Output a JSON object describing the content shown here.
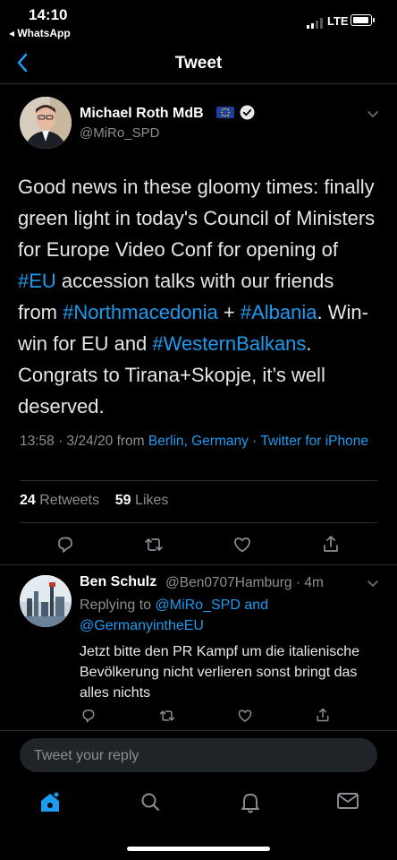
{
  "status_bar": {
    "time": "14:10",
    "back_app": "◂ WhatsApp",
    "network": "LTE"
  },
  "header": {
    "title": "Tweet"
  },
  "tweet": {
    "author_name": "Michael Roth MdB",
    "author_handle": "@MiRo_SPD",
    "text_segments": [
      {
        "t": "Good news in these gloomy times: finally green light in today's Council of Ministers for Europe Video Conf for opening of ",
        "link": false
      },
      {
        "t": "#EU",
        "link": true
      },
      {
        "t": " accession talks with our friends from ",
        "link": false
      },
      {
        "t": "#Northmacedonia",
        "link": true
      },
      {
        "t": " + ",
        "link": false
      },
      {
        "t": "#Albania",
        "link": true
      },
      {
        "t": ". Win-win for EU and ",
        "link": false
      },
      {
        "t": "#WesternBalkans",
        "link": true
      },
      {
        "t": ". Congrats to Tirana+Skopje, it’s well deserved.",
        "link": false
      }
    ],
    "time_date": "13:58 · 3/24/20 from ",
    "location": "Berlin, Germany",
    "sep": " · ",
    "source": "Twitter for iPhone",
    "retweets_count": "24",
    "retweets_label": "Retweets",
    "likes_count": "59",
    "likes_label": "Likes"
  },
  "reply": {
    "author_name": "Ben Schulz",
    "handle_time": "@Ben0707Hamburg · 4m",
    "replying_prefix": "Replying to ",
    "replying_to_1": "@MiRo_SPD",
    "replying_and": " and",
    "replying_to_2": "@GermanyintheEU",
    "text": "Jetzt bitte den PR Kampf um die italienische Bevölkerung nicht verlieren sonst bringt das alles nichts"
  },
  "compose": {
    "placeholder": "Tweet your reply"
  },
  "colors": {
    "accent": "#1d9bf0",
    "background": "#000000",
    "muted": "#8b8f94"
  },
  "icons": {
    "tab_bar": [
      "home-icon",
      "search-icon",
      "bell-icon",
      "mail-icon"
    ],
    "actions": [
      "reply-icon",
      "retweet-icon",
      "like-icon",
      "share-icon"
    ]
  }
}
